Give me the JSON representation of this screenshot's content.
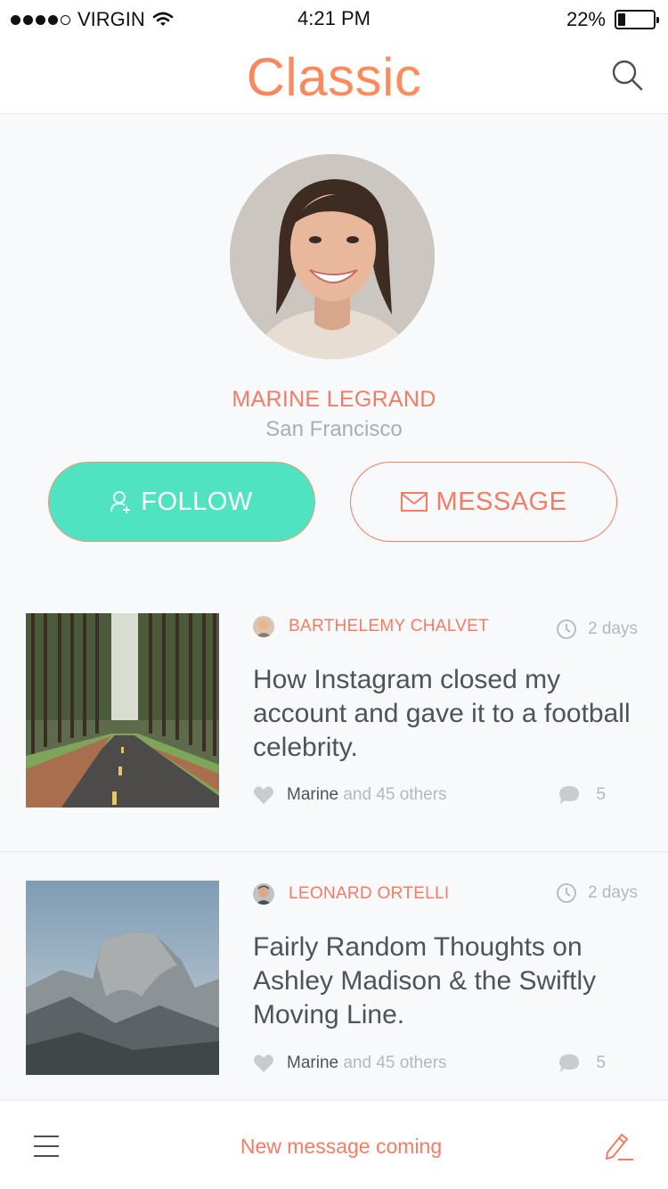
{
  "status_bar": {
    "carrier": "VIRGIN",
    "time": "4:21 PM",
    "battery": "22%",
    "battery_level": 0.22,
    "signal_dots_filled": 4,
    "signal_dots_total": 5
  },
  "header": {
    "title": "Classic",
    "search_icon": "search-icon",
    "title_gradient": [
      "#fd7a6a",
      "#fb9a4e"
    ]
  },
  "profile": {
    "name": "MARINE LEGRAND",
    "location": "San Francisco",
    "follow_label": "FOLLOW",
    "message_label": "MESSAGE"
  },
  "feed": [
    {
      "author": "BARTHELEMY CHALVET",
      "time": "2 days",
      "title": "How Instagram closed my account and gave it to a football celebrity.",
      "likes_user": "Marine",
      "likes_others": "and 45 others",
      "comments": "5"
    },
    {
      "author": "LEONARD ORTELLI",
      "time": "2 days",
      "title": "Fairly Random Thoughts on Ashley Madison & the Swiftly Moving Line.",
      "likes_user": "Marine",
      "likes_others": "and 45 others",
      "comments": "5"
    }
  ],
  "bottom_bar": {
    "status_text": "New message coming",
    "menu_icon": "hamburger-menu-icon",
    "compose_icon": "pencil-icon"
  },
  "colors": {
    "accent": "#f47c64",
    "follow_button": "#50e3c2",
    "muted_text": "#b4b8be"
  }
}
